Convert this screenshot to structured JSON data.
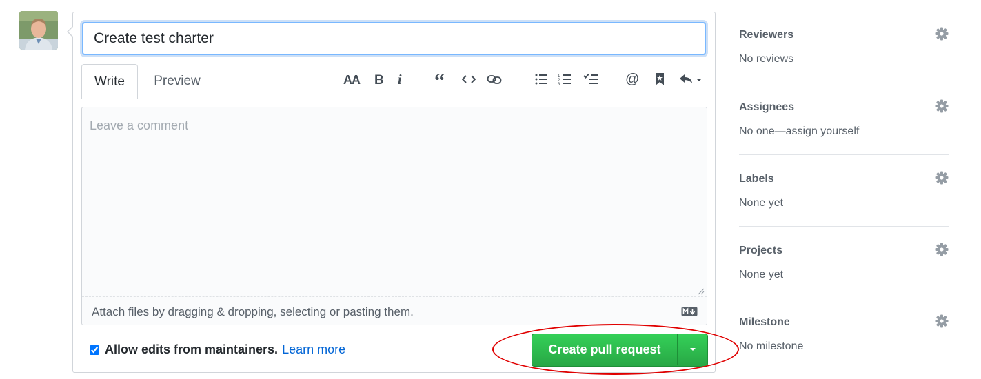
{
  "title_input": {
    "value": "Create test charter"
  },
  "tabs": [
    {
      "label": "Write",
      "active": true
    },
    {
      "label": "Preview",
      "active": false
    }
  ],
  "toolbar": {
    "icons": [
      "text-size-icon",
      "bold-icon",
      "italic-icon",
      "quote-icon",
      "code-icon",
      "link-icon",
      "bulleted-list-icon",
      "numbered-list-icon",
      "task-list-icon",
      "mention-icon",
      "bookmark-icon",
      "reply-icon"
    ]
  },
  "editor": {
    "placeholder": "Leave a comment",
    "attach_text": "Attach files by dragging & dropping, selecting or pasting them."
  },
  "allow_edits": {
    "checked": true,
    "label": "Allow edits from maintainers.",
    "link": "Learn more"
  },
  "submit": {
    "label": "Create pull request"
  },
  "sidebar": {
    "reviewers": {
      "heading": "Reviewers",
      "value": "No reviews"
    },
    "assignees": {
      "heading": "Assignees",
      "value": "No one—assign yourself"
    },
    "labels": {
      "heading": "Labels",
      "value": "None yet"
    },
    "projects": {
      "heading": "Projects",
      "value": "None yet"
    },
    "milestone": {
      "heading": "Milestone",
      "value": "No milestone"
    }
  },
  "colors": {
    "primary_button": "#2cbe4e",
    "link": "#0366d6",
    "focus_border": "#79b8ff",
    "annotation": "#e00000"
  }
}
